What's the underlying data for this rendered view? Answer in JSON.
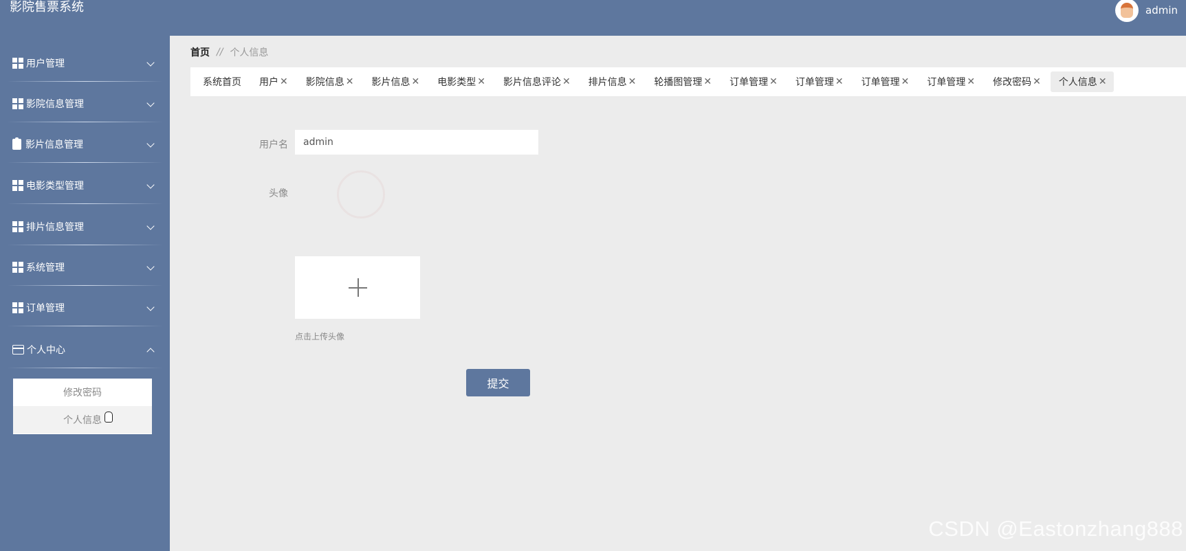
{
  "header": {
    "app_title": "影院售票系统",
    "user_name": "admin"
  },
  "sidebar": {
    "items": [
      {
        "label": "用户管理",
        "icon": "grid-icon"
      },
      {
        "label": "影院信息管理",
        "icon": "grid-icon"
      },
      {
        "label": "影片信息管理",
        "icon": "clipboard-icon"
      },
      {
        "label": "电影类型管理",
        "icon": "grid-icon"
      },
      {
        "label": "排片信息管理",
        "icon": "grid-icon"
      },
      {
        "label": "系统管理",
        "icon": "grid-icon"
      },
      {
        "label": "订单管理",
        "icon": "grid-icon"
      },
      {
        "label": "个人中心",
        "icon": "wallet-icon"
      }
    ],
    "submenu": [
      {
        "label": "修改密码"
      },
      {
        "label": "个人信息"
      }
    ]
  },
  "breadcrumb": {
    "home": "首页",
    "separator": "//",
    "current": "个人信息"
  },
  "tabs": [
    {
      "label": "系统首页",
      "closable": false
    },
    {
      "label": "用户",
      "closable": true
    },
    {
      "label": "影院信息",
      "closable": true
    },
    {
      "label": "影片信息",
      "closable": true
    },
    {
      "label": "电影类型",
      "closable": true
    },
    {
      "label": "影片信息评论",
      "closable": true
    },
    {
      "label": "排片信息",
      "closable": true
    },
    {
      "label": "轮播图管理",
      "closable": true
    },
    {
      "label": "订单管理",
      "closable": true
    },
    {
      "label": "订单管理",
      "closable": true
    },
    {
      "label": "订单管理",
      "closable": true
    },
    {
      "label": "订单管理",
      "closable": true
    },
    {
      "label": "修改密码",
      "closable": true
    },
    {
      "label": "个人信息",
      "closable": true,
      "active": true
    }
  ],
  "form": {
    "username_label": "用户名",
    "username_value": "admin",
    "avatar_label": "头像",
    "upload_hint": "点击上传头像",
    "submit_label": "提交"
  },
  "watermark": "CSDN @Eastonzhang888",
  "colors": {
    "primary": "#5e779e",
    "background": "#ececec"
  }
}
